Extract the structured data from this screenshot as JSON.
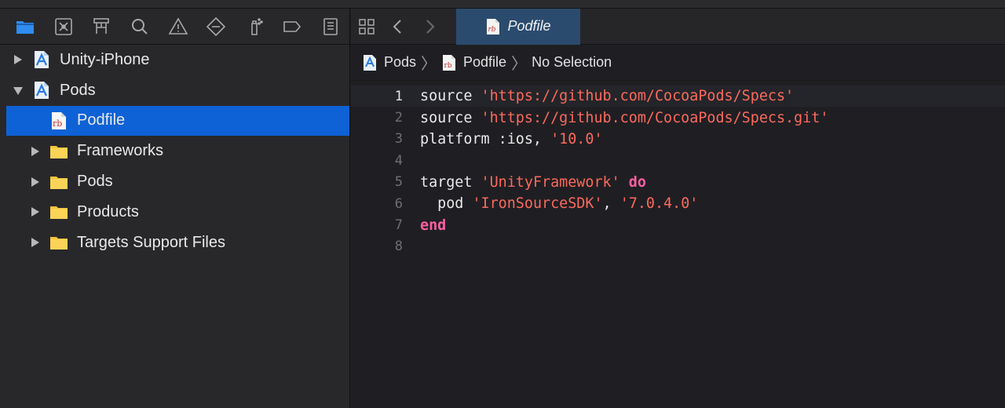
{
  "navigator": {
    "tabs": [
      {
        "name": "project-navigator",
        "icon": "folder-icon",
        "active": true
      },
      {
        "name": "source-control-navigator",
        "icon": "source-control-icon"
      },
      {
        "name": "symbol-navigator",
        "icon": "hierarchy-icon"
      },
      {
        "name": "find-navigator",
        "icon": "search-icon"
      },
      {
        "name": "issue-navigator",
        "icon": "warning-icon"
      },
      {
        "name": "test-navigator",
        "icon": "test-diamond-icon"
      },
      {
        "name": "debug-navigator",
        "icon": "spray-icon"
      },
      {
        "name": "breakpoint-navigator",
        "icon": "breakpoint-tag-icon"
      },
      {
        "name": "report-navigator",
        "icon": "report-icon"
      }
    ],
    "tree": [
      {
        "label": "Unity-iPhone",
        "indent": 0,
        "disclosure": "closed",
        "icon": "xcode-project-icon"
      },
      {
        "label": "Pods",
        "indent": 0,
        "disclosure": "open",
        "icon": "xcode-project-icon"
      },
      {
        "label": "Podfile",
        "indent": 1,
        "disclosure": "none",
        "icon": "ruby-file-icon",
        "selected": true
      },
      {
        "label": "Frameworks",
        "indent": 1,
        "disclosure": "closed",
        "icon": "folder-icon"
      },
      {
        "label": "Pods",
        "indent": 1,
        "disclosure": "closed",
        "icon": "folder-icon"
      },
      {
        "label": "Products",
        "indent": 1,
        "disclosure": "closed",
        "icon": "folder-icon"
      },
      {
        "label": "Targets Support Files",
        "indent": 1,
        "disclosure": "closed",
        "icon": "folder-icon"
      }
    ]
  },
  "editor": {
    "tab_title": "Podfile",
    "jumpbar": {
      "project": "Pods",
      "file": "Podfile",
      "selection": "No Selection"
    },
    "current_line": 1,
    "lines": [
      {
        "num": "1",
        "tokens": [
          {
            "t": "plain",
            "v": "source "
          },
          {
            "t": "str",
            "v": "'https://github.com/CocoaPods/Specs'"
          }
        ]
      },
      {
        "num": "2",
        "tokens": [
          {
            "t": "plain",
            "v": "source "
          },
          {
            "t": "str",
            "v": "'https://github.com/CocoaPods/Specs.git'"
          }
        ]
      },
      {
        "num": "3",
        "tokens": [
          {
            "t": "plain",
            "v": "platform :ios, "
          },
          {
            "t": "str",
            "v": "'10.0'"
          }
        ]
      },
      {
        "num": "4",
        "tokens": []
      },
      {
        "num": "5",
        "tokens": [
          {
            "t": "plain",
            "v": "target "
          },
          {
            "t": "str",
            "v": "'UnityFramework'"
          },
          {
            "t": "plain",
            "v": " "
          },
          {
            "t": "kw",
            "v": "do"
          }
        ]
      },
      {
        "num": "6",
        "tokens": [
          {
            "t": "plain",
            "v": "  pod "
          },
          {
            "t": "str",
            "v": "'IronSourceSDK'"
          },
          {
            "t": "plain",
            "v": ", "
          },
          {
            "t": "str",
            "v": "'7.0.4.0'"
          }
        ]
      },
      {
        "num": "7",
        "tokens": [
          {
            "t": "kw",
            "v": "end"
          }
        ]
      },
      {
        "num": "8",
        "tokens": []
      }
    ]
  },
  "colors": {
    "selection": "#0e62d6",
    "string": "#fc6a5d",
    "keyword": "#fc5fa3",
    "active_tab": "#2f8cf0"
  }
}
